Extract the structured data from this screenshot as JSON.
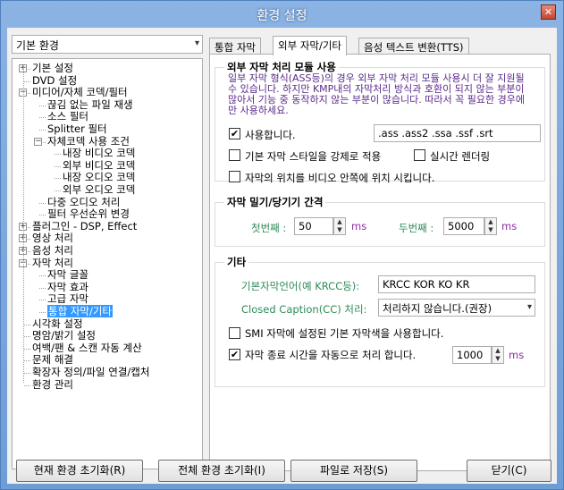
{
  "window": {
    "title": "환경 설정"
  },
  "combo": {
    "value": "기본 환경"
  },
  "tree": [
    {
      "label": "기본 설정",
      "exp": "+"
    },
    {
      "label": "DVD 설정",
      "exp": ""
    },
    {
      "label": "미디어/자체 코덱/필터",
      "exp": "−"
    },
    {
      "label": "끊김 없는 파일 재생",
      "exp": ""
    },
    {
      "label": "소스 필터",
      "exp": ""
    },
    {
      "label": "Splitter 필터",
      "exp": ""
    },
    {
      "label": "자체코덱 사용 조건",
      "exp": "−"
    },
    {
      "label": "내장 비디오 코덱",
      "exp": ""
    },
    {
      "label": "외부 비디오 코덱",
      "exp": ""
    },
    {
      "label": "내장 오디오 코덱",
      "exp": ""
    },
    {
      "label": "외부 오디오 코덱",
      "exp": ""
    },
    {
      "label": "다중 오디오 처리",
      "exp": ""
    },
    {
      "label": "필터 우선순위 변경",
      "exp": ""
    },
    {
      "label": "플러그인 - DSP, Effect",
      "exp": "+"
    },
    {
      "label": "영상 처리",
      "exp": "+"
    },
    {
      "label": "음성 처리",
      "exp": "+"
    },
    {
      "label": "자막 처리",
      "exp": "−"
    },
    {
      "label": "자막 글꼴",
      "exp": ""
    },
    {
      "label": "자막 효과",
      "exp": ""
    },
    {
      "label": "고급 자막",
      "exp": ""
    },
    {
      "label": "통합 자막/기타",
      "exp": ""
    },
    {
      "label": "시각화 설정",
      "exp": ""
    },
    {
      "label": "명암/밝기 설정",
      "exp": ""
    },
    {
      "label": "여백/팬 & 스캔 자동 계산",
      "exp": ""
    },
    {
      "label": "문제 해결",
      "exp": ""
    },
    {
      "label": "확장자 정의/파일 연결/캡처",
      "exp": ""
    },
    {
      "label": "환경 관리",
      "exp": ""
    }
  ],
  "tabs": [
    "통합 자막",
    "외부 자막/기타",
    "음성 텍스트 변환(TTS)"
  ],
  "module": {
    "title": "외부 자막 처리 모듈 사용",
    "warning": "일부 자막 형식(ASS등)의 경우 외부 자막 처리 모듈 사용시 더 잘 지원될 수 있습니다. 하지만 KMP내의 자막처리 방식과 호환이 되지 않는 부분이 많아서 기능 중 동작하지 않는 부분이 많습니다. 따라서 꼭 필요한 경우에만 사용하세요.",
    "use_label": "사용합니다.",
    "use_checked": true,
    "extensions": ".ass .ass2 .ssa .ssf .srt",
    "force_style_label": "기본 자막 스타일을 강제로 적용",
    "realtime_label": "실시간 렌더링",
    "inside_label": "자막의 위치를 비디오 안쪽에 위치 시킵니다."
  },
  "delay": {
    "title": "자막 밀기/당기기 간격",
    "first_label": "첫번째 :",
    "first_value": "50",
    "second_label": "두번째 :",
    "second_value": "5000",
    "unit": "ms"
  },
  "etc": {
    "title": "기타",
    "lang_label": "기본자막언어(예 KRCC등):",
    "lang_value": "KRCC KOR KO KR",
    "cc_label": "Closed Caption(CC) 처리:",
    "cc_value": "처리하지 않습니다.(권장)",
    "smi_label": "SMI 자막에 설정된 기본 자막색을 사용합니다.",
    "smi_checked": false,
    "endtime_label": "자막 종료 시간을 자동으로 처리 합니다.",
    "endtime_checked": true,
    "endtime_value": "1000",
    "unit": "ms"
  },
  "buttons": {
    "reset_current": "현재 환경 초기화(R)",
    "reset_all": "전체 환경 초기화(I)",
    "save_file": "파일로 저장(S)",
    "close": "닫기(C)"
  }
}
